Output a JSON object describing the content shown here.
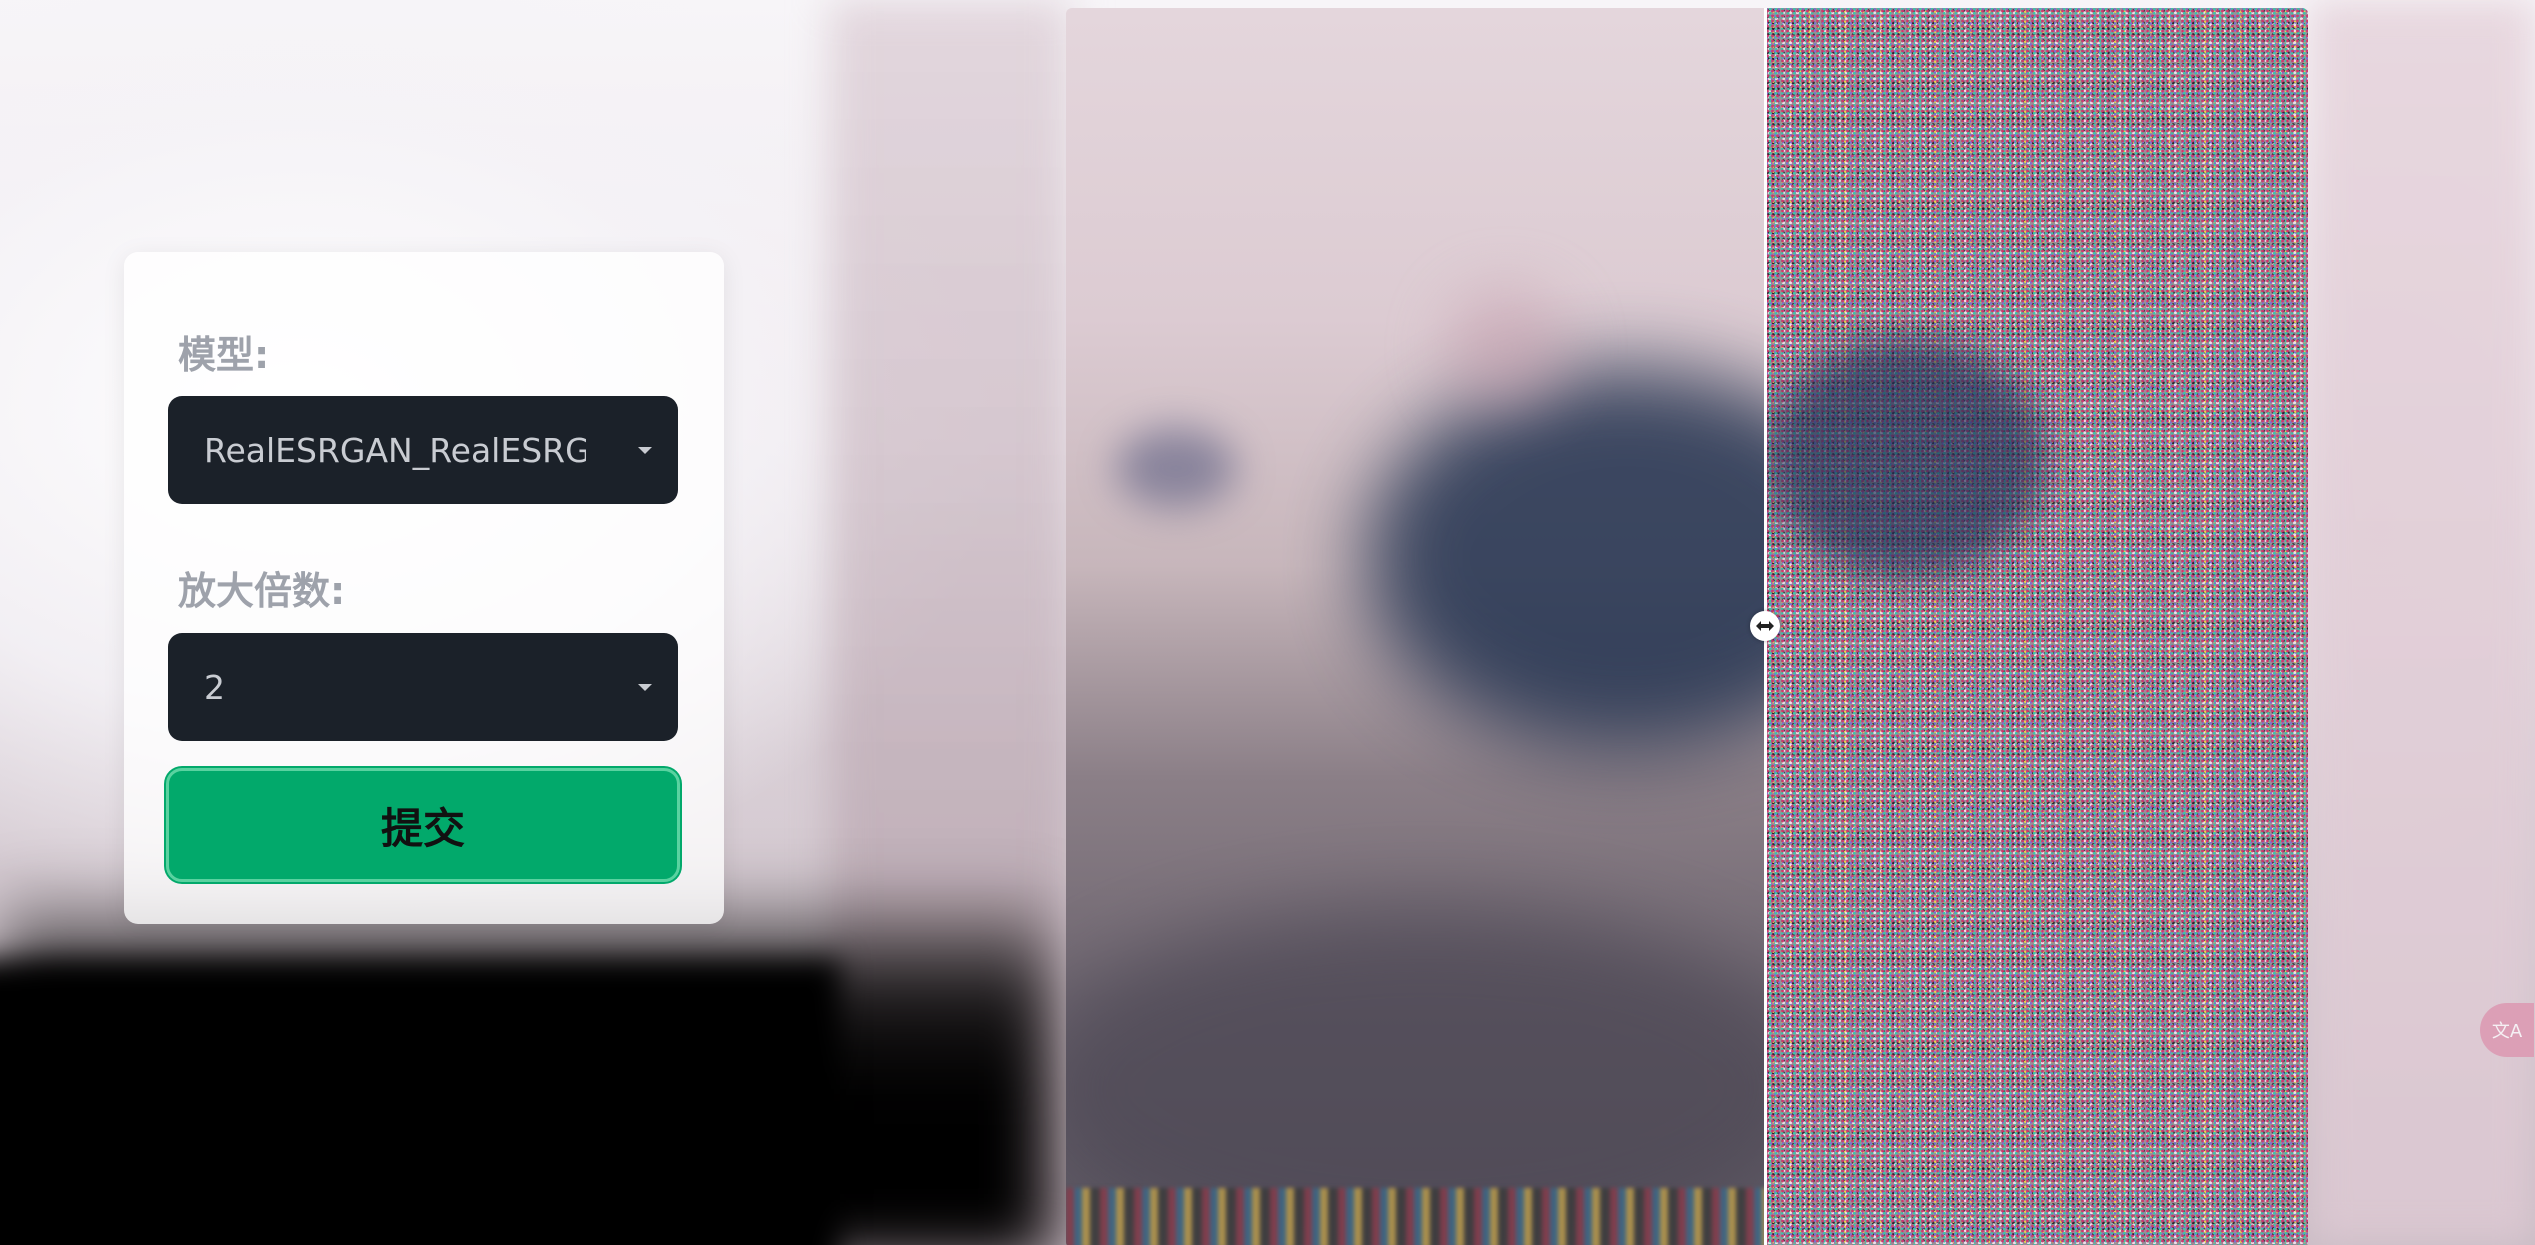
{
  "settings": {
    "model_label": "模型:",
    "model_value": "RealESRGAN_RealESRGAN",
    "scale_label": "放大倍数:",
    "scale_value": "2",
    "submit_label": "提交"
  },
  "translate_fab": {
    "glyph": "文A"
  },
  "compare": {
    "handle_icon": "left-right-arrows-icon"
  },
  "colors": {
    "select_bg": "#1b2129",
    "submit_bg": "#02a96b",
    "label": "#9ea2ab"
  }
}
